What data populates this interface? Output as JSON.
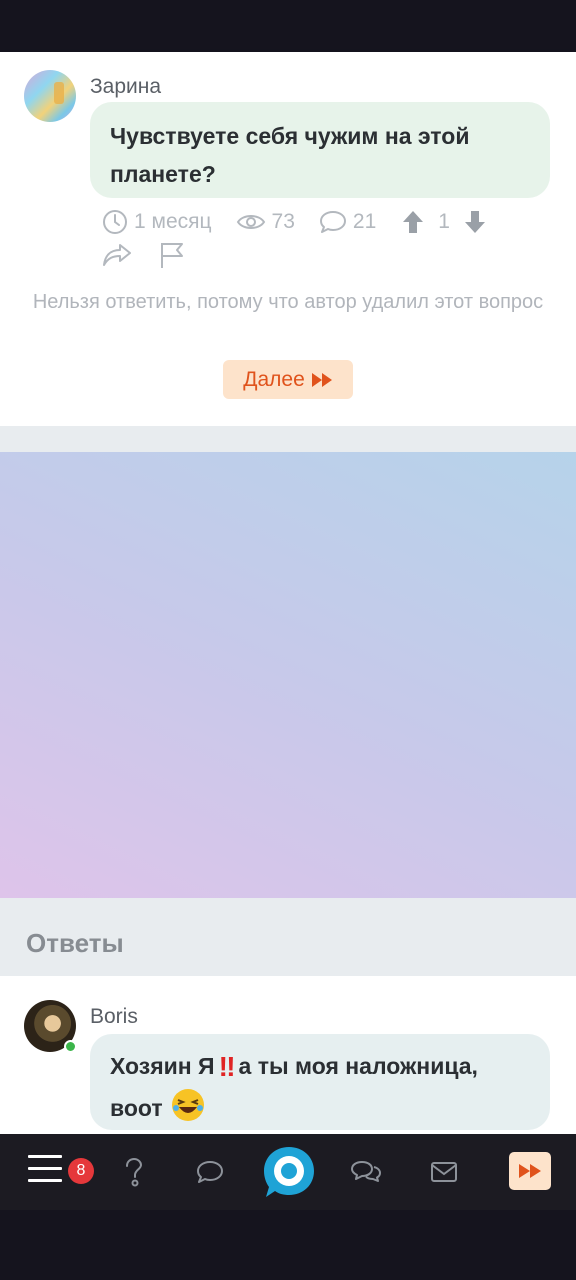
{
  "question": {
    "author": "Зарина",
    "text": "Чувствуете себя чужим на этой планете?",
    "time": "1 месяц",
    "views": "73",
    "comments": "21",
    "votes": "1",
    "notice": "Нельзя ответить, потому что автор удалил этот вопрос",
    "more_label": "Далее"
  },
  "answers": {
    "heading": "Ответы",
    "items": [
      {
        "author": "Boris",
        "text_part1": "Хозяин Я",
        "text_part2": "а ты моя наложница, воот",
        "emoji": "‼",
        "online": true
      }
    ]
  },
  "nav": {
    "notifications_count": "8",
    "icons": [
      "menu-icon",
      "question-icon",
      "chat-icon",
      "logo-icon",
      "chats-icon",
      "mail-icon",
      "fast-forward-icon"
    ]
  },
  "colors": {
    "accent": "#e0531c",
    "accent_bg": "#fde3cb",
    "badge": "#e5383b",
    "logo": "#1fa3d6",
    "online": "#3bb54a"
  }
}
